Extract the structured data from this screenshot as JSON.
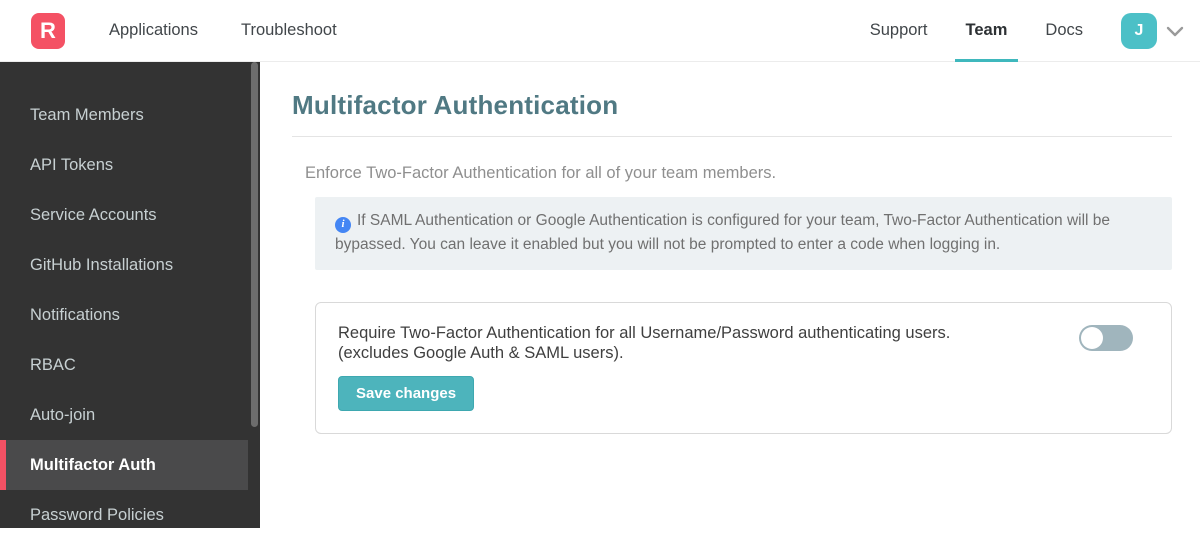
{
  "navbar": {
    "logo_letter": "R",
    "left_links": [
      {
        "label": "Applications"
      },
      {
        "label": "Troubleshoot"
      }
    ],
    "right_links": [
      {
        "label": "Support",
        "active": false
      },
      {
        "label": "Team",
        "active": true
      },
      {
        "label": "Docs",
        "active": false
      }
    ],
    "avatar_initial": "J"
  },
  "sidebar": {
    "items": [
      {
        "label": "Team Members",
        "active": false
      },
      {
        "label": "API Tokens",
        "active": false
      },
      {
        "label": "Service Accounts",
        "active": false
      },
      {
        "label": "GitHub Installations",
        "active": false
      },
      {
        "label": "Notifications",
        "active": false
      },
      {
        "label": "RBAC",
        "active": false
      },
      {
        "label": "Auto-join",
        "active": false
      },
      {
        "label": "Multifactor Auth",
        "active": true
      },
      {
        "label": "Password Policies",
        "active": false
      }
    ]
  },
  "main": {
    "title": "Multifactor Authentication",
    "description": "Enforce Two-Factor Authentication for all of your team members.",
    "info_icon_glyph": "i",
    "info_note": "If SAML Authentication or Google Authentication is configured for your team, Two-Factor Authentication will be bypassed. You can leave it enabled but you will not be prompted to enter a code when logging in.",
    "setting": {
      "label_line1": "Require Two-Factor Authentication for all Username/Password authenticating users.",
      "label_line2": "(excludes Google Auth & SAML users).",
      "toggle_state": "off",
      "save_button_label": "Save changes"
    }
  },
  "colors": {
    "brand_red": "#f45164",
    "accent_teal": "#3fb8bd",
    "avatar_teal": "#4cc0c7",
    "title_slate": "#507983",
    "sidebar_bg": "#333333",
    "sidebar_active_bg": "#4a4a4b",
    "info_icon_blue": "#4486f4",
    "button_teal": "#4db4bc",
    "toggle_off_track": "#a0b5bd"
  }
}
